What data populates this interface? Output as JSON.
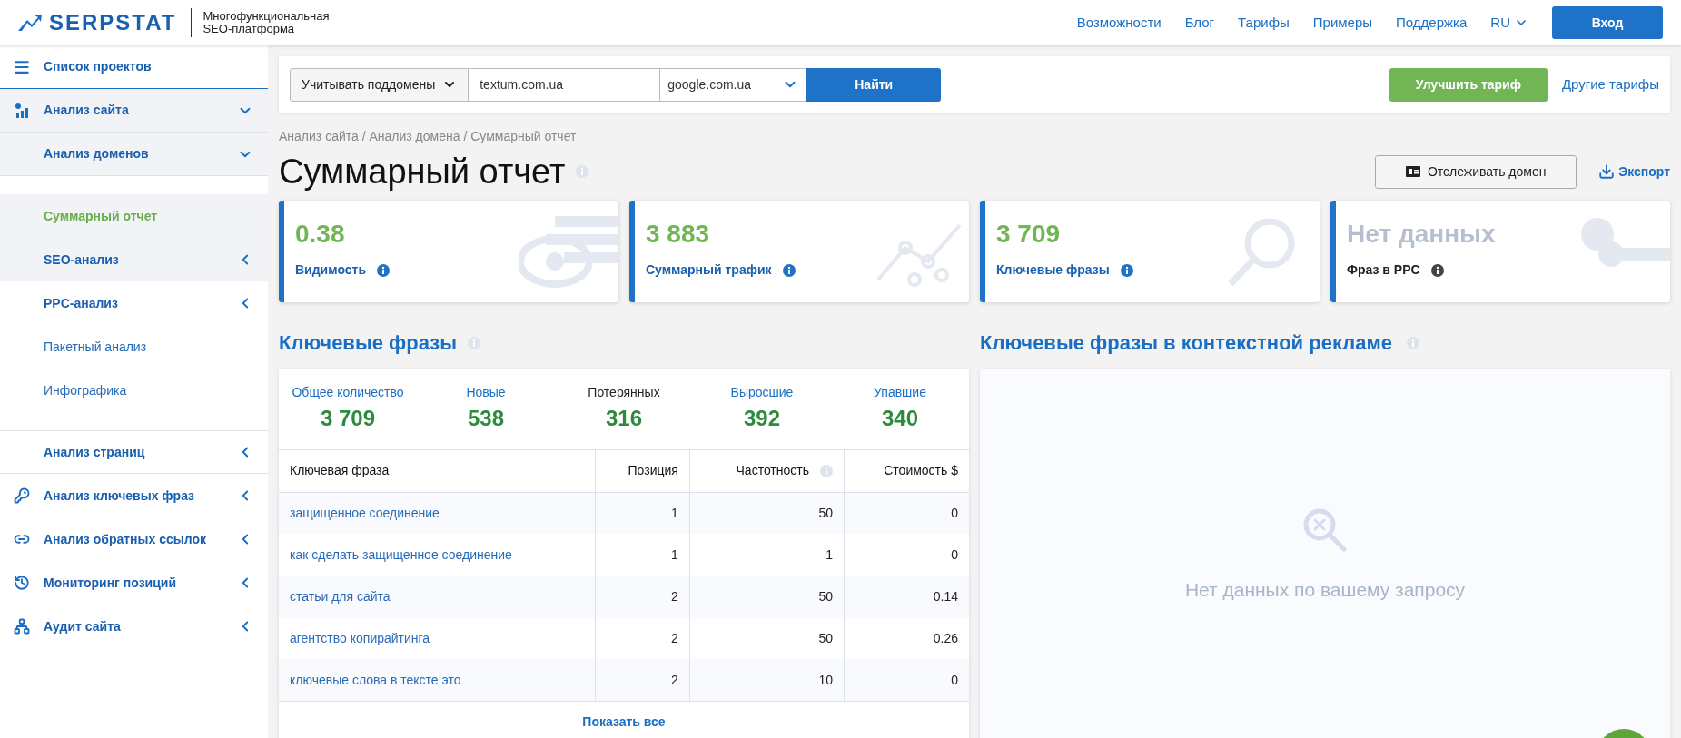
{
  "header": {
    "logo": "SERPSTAT",
    "tagline": [
      "Многофункциональная",
      "SEO-платформа"
    ],
    "nav": [
      "Возможности",
      "Блог",
      "Тарифы",
      "Примеры",
      "Поддержка"
    ],
    "language": "RU",
    "login": "Вход"
  },
  "sidebar": {
    "items": [
      {
        "label": "Список проектов"
      },
      {
        "label": "Анализ сайта",
        "expanded": true,
        "children": [
          {
            "label": "Анализ доменов",
            "expanded": true,
            "children": [
              {
                "label": "Суммарный отчет",
                "selected": true,
                "highlighted": true
              },
              {
                "label": "SEO-анализ",
                "selected": false,
                "highlighted": true,
                "expanded": false
              },
              {
                "label": "PPC-анализ",
                "selected": false,
                "highlighted": false,
                "expanded": false
              },
              {
                "label": "Пакетный анализ",
                "selected": false,
                "highlighted": false
              },
              {
                "label": "Инфографика",
                "selected": false,
                "highlighted": false
              }
            ]
          },
          {
            "label": "Анализ страниц",
            "expanded": false
          }
        ]
      },
      {
        "label": "Анализ ключевых фраз",
        "expanded": false
      },
      {
        "label": "Анализ обратных ссылок",
        "expanded": false
      },
      {
        "label": "Мониторинг позиций",
        "expanded": false
      },
      {
        "label": "Аудит сайта",
        "expanded": false
      }
    ]
  },
  "search": {
    "subdomains": "Учитывать поддомены",
    "domain": "textum.com.ua",
    "engine": "google.com.ua",
    "submit": "Найти",
    "upgrade": "Улучшить тариф",
    "other_plans": "Другие тарифы"
  },
  "breadcrumb": "Анализ сайта / Анализ домена / Суммарный отчет",
  "title": "Суммарный отчет",
  "track_button": "Отслеживать домен",
  "export": "Экспорт",
  "metric_cards": [
    {
      "value": "0.38",
      "label": "Видимость",
      "has_data": true
    },
    {
      "value": "3 883",
      "label": "Суммарный трафик",
      "has_data": true
    },
    {
      "value": "3 709",
      "label": "Ключевые фразы",
      "has_data": true
    },
    {
      "value": "Нет данных",
      "label": "Фраз в PPC",
      "has_data": false
    }
  ],
  "keywords": {
    "title": "Ключевые фразы",
    "stats": [
      {
        "label": "Общее количество",
        "value": "3 709",
        "color": "#1a6fc4"
      },
      {
        "label": "Новые",
        "value": "538",
        "color": "#1a6fc4"
      },
      {
        "label": "Потерянных",
        "value": "316",
        "color": "#222222"
      },
      {
        "label": "Выросшие",
        "value": "392",
        "color": "#1a6fc4"
      },
      {
        "label": "Упавшие",
        "value": "340",
        "color": "#1a6fc4"
      }
    ],
    "columns": [
      {
        "label": "Ключевая фраза",
        "info": false
      },
      {
        "label": "Позиция",
        "info": false
      },
      {
        "label": "Частотность",
        "info": true
      },
      {
        "label": "Стоимость $",
        "info": false
      }
    ],
    "rows": [
      [
        "защищенное соединение",
        "1",
        "50",
        "0"
      ],
      [
        "как сделать защищенное соединение",
        "1",
        "1",
        "0"
      ],
      [
        "статьи для сайта",
        "2",
        "50",
        "0.14"
      ],
      [
        "агентство копирайтинга",
        "2",
        "50",
        "0.26"
      ],
      [
        "ключевые слова в тексте это",
        "2",
        "10",
        "0"
      ]
    ],
    "show_all": "Показать все"
  },
  "ppc": {
    "title": "Ключевые фразы в контекстной рекламе",
    "empty_message": "Нет данных по вашему запросу"
  }
}
